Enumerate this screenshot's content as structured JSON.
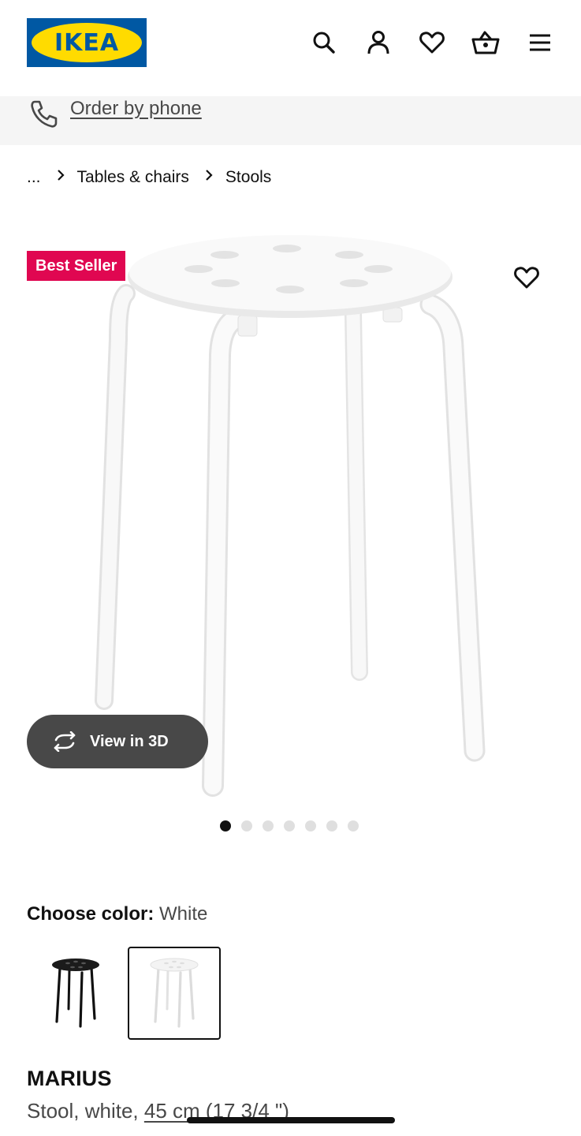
{
  "header": {
    "logo_text": "IKEA",
    "icons": [
      "search-icon",
      "account-icon",
      "heart-icon",
      "basket-icon",
      "menu-icon"
    ]
  },
  "phone_bar": {
    "label": "Order by phone",
    "icon": "phone-icon"
  },
  "breadcrumb": {
    "items": [
      "...",
      "Tables & chairs",
      "Stools"
    ]
  },
  "gallery": {
    "badge": "Best Seller",
    "view_3d_label": "View in 3D",
    "dot_count": 7,
    "active_dot": 0
  },
  "color_choice": {
    "label": "Choose color:",
    "value": "White",
    "options": [
      "black",
      "white"
    ],
    "selected": "white"
  },
  "product": {
    "name": "MARIUS",
    "description": "Stool, white, ",
    "size": "45 cm (17 3/4 \")"
  },
  "colors": {
    "brand_blue": "#0058a3",
    "brand_yellow": "#ffdb00",
    "badge_red": "#e00751",
    "button_dark": "#484848"
  }
}
